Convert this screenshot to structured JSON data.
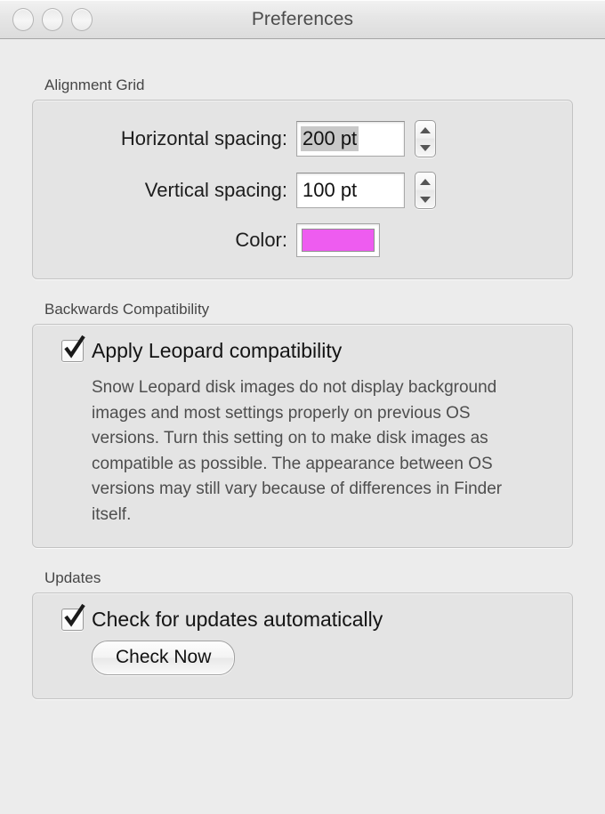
{
  "window": {
    "title": "Preferences",
    "traffic_lights": [
      {
        "name": "close-button",
        "state": "inactive"
      },
      {
        "name": "minimize-button",
        "state": "inactive"
      },
      {
        "name": "zoom-button",
        "state": "inactive"
      }
    ]
  },
  "alignment_grid": {
    "group_label": "Alignment Grid",
    "horizontal": {
      "label": "Horizontal spacing:",
      "value": "200 pt",
      "selected": true
    },
    "vertical": {
      "label": "Vertical spacing:",
      "value": "100 pt",
      "selected": false
    },
    "color": {
      "label": "Color:",
      "swatch_hex": "#ee5cf0"
    }
  },
  "backwards_compatibility": {
    "group_label": "Backwards Compatibility",
    "checkbox_label": "Apply Leopard compatibility",
    "checked": true,
    "description": "Snow Leopard disk images do not display background images and most settings properly on previous OS versions. Turn this setting on to make disk images as compatible as possible. The appearance between OS versions may still vary because of differences in Finder itself."
  },
  "updates": {
    "group_label": "Updates",
    "checkbox_label": "Check for updates automatically",
    "checked": true,
    "check_now_button": "Check Now"
  }
}
